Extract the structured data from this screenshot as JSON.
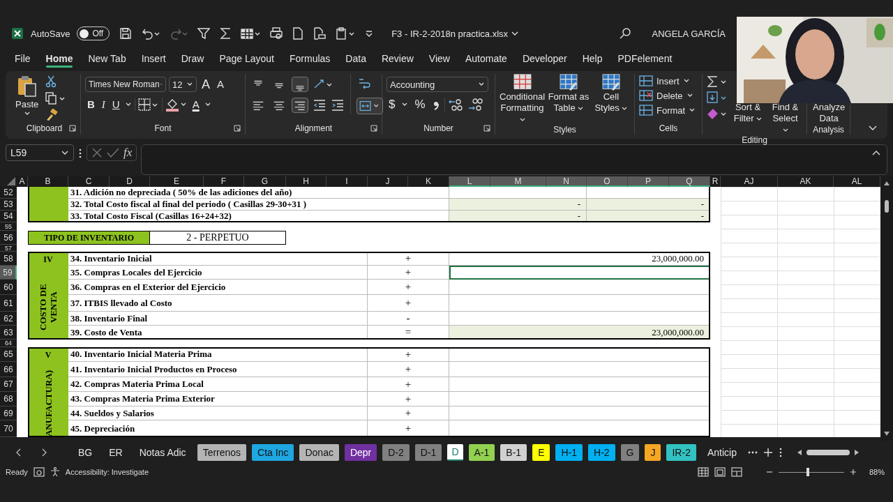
{
  "title_bar": {
    "autosave_label": "AutoSave",
    "autosave": {
      "label": "Off",
      "on": false
    },
    "file_name": "F3 - IR-2-2018n practica.xlsx",
    "user": "ANGELA GARCÍA"
  },
  "menu_tabs": [
    {
      "label": "File",
      "selected": false
    },
    {
      "label": "Home",
      "selected": true
    },
    {
      "label": "New Tab",
      "selected": false
    },
    {
      "label": "Insert",
      "selected": false
    },
    {
      "label": "Draw",
      "selected": false
    },
    {
      "label": "Page Layout",
      "selected": false
    },
    {
      "label": "Formulas",
      "selected": false
    },
    {
      "label": "Data",
      "selected": false
    },
    {
      "label": "Review",
      "selected": false
    },
    {
      "label": "View",
      "selected": false
    },
    {
      "label": "Automate",
      "selected": false
    },
    {
      "label": "Developer",
      "selected": false
    },
    {
      "label": "Help",
      "selected": false
    },
    {
      "label": "PDFelement",
      "selected": false
    }
  ],
  "ribbon": {
    "clipboard": {
      "paste": "Paste",
      "label": "Clipboard"
    },
    "font": {
      "name": "Times New Roman",
      "size": "12",
      "grow": "A",
      "shrink": "A",
      "bold": "B",
      "italic": "I",
      "underline": "U",
      "font_color_label": "A",
      "label": "Font"
    },
    "alignment": {
      "label": "Alignment",
      "vertical_buttons": [
        {
          "kind": "top",
          "selected": false
        },
        {
          "kind": "middle",
          "selected": false
        },
        {
          "kind": "bottom",
          "selected": true
        }
      ],
      "horizontal_buttons": [
        {
          "kind": "left",
          "selected": false
        },
        {
          "kind": "center",
          "selected": false
        },
        {
          "kind": "right",
          "selected": true
        }
      ],
      "merge": {
        "selected": true
      }
    },
    "number": {
      "format": "Accounting",
      "currency": "$",
      "percent": "%",
      "label": "Number"
    },
    "styles": {
      "buttons": [
        "Conditional Formatting",
        "Format as Table",
        "Cell Styles"
      ],
      "label": "Styles"
    },
    "cells": {
      "buttons": [
        "Insert",
        "Delete",
        "Format"
      ],
      "label": "Cells"
    },
    "editing": {
      "buttons": [
        "Sort & Filter",
        "Find & Select"
      ],
      "label": "Editing"
    },
    "analysis": {
      "buttons": [
        "Analyze Data"
      ],
      "label": "Analysis"
    }
  },
  "formula_bar": {
    "name_box": "L59",
    "function_label": "fx"
  },
  "sheet": {
    "columns": [
      {
        "label": "A",
        "selected": false
      },
      {
        "label": "B",
        "selected": false
      },
      {
        "label": "C",
        "selected": false
      },
      {
        "label": "D",
        "selected": false
      },
      {
        "label": "E",
        "selected": false
      },
      {
        "label": "F",
        "selected": false
      },
      {
        "label": "G",
        "selected": false
      },
      {
        "label": "H",
        "selected": false
      },
      {
        "label": "I",
        "selected": false
      },
      {
        "label": "J",
        "selected": false
      },
      {
        "label": "K",
        "selected": false
      },
      {
        "label": "L",
        "selected": true
      },
      {
        "label": "M",
        "selected": true
      },
      {
        "label": "N",
        "selected": true
      },
      {
        "label": "O",
        "selected": true
      },
      {
        "label": "P",
        "selected": true
      },
      {
        "label": "Q",
        "selected": true
      },
      {
        "label": "R",
        "selected": false
      },
      {
        "label": "AJ",
        "selected": false
      },
      {
        "label": "AK",
        "selected": false
      },
      {
        "label": "AL",
        "selected": false
      }
    ],
    "row_numbers": [
      {
        "label": "52",
        "selected": false
      },
      {
        "label": "53",
        "selected": false
      },
      {
        "label": "54",
        "selected": false
      },
      {
        "label": "55",
        "selected": false
      },
      {
        "label": "56",
        "selected": false
      },
      {
        "label": "57",
        "selected": false
      },
      {
        "label": "58",
        "selected": false
      },
      {
        "label": "59",
        "selected": true
      },
      {
        "label": "60",
        "selected": false
      },
      {
        "label": "61",
        "selected": false
      },
      {
        "label": "62",
        "selected": false
      },
      {
        "label": "63",
        "selected": false
      },
      {
        "label": "64",
        "selected": false
      },
      {
        "label": "65",
        "selected": false
      },
      {
        "label": "66",
        "selected": false
      },
      {
        "label": "67",
        "selected": false
      },
      {
        "label": "68",
        "selected": false
      },
      {
        "label": "69",
        "selected": false
      },
      {
        "label": "70",
        "selected": false
      }
    ],
    "top_lines": [
      {
        "label": "31.  Adición no depreciada  ( 50%  de las adiciones del año)",
        "shaded": false
      },
      {
        "label": "32. Total Costo  fiscal al final del periodo ( Casillas 29-30+31 )",
        "left_amount": "-",
        "right_amount": "-",
        "shaded": true
      },
      {
        "label": "33. Total Costo Fiscal (Casillas 16+24+32)",
        "left_amount": "-",
        "right_amount": "-",
        "shaded": true
      }
    ],
    "inventory_type": {
      "label": "TIPO DE INVENTARIO",
      "value": "2 - PERPETUO"
    },
    "sections": [
      {
        "roman": "IV",
        "title": "COSTO DE VENTA",
        "lines": [
          {
            "label": "34. Inventario Inicial",
            "sign": "+",
            "amount": "23,000,000.00",
            "shaded": false,
            "selected": false
          },
          {
            "label": "35. Compras Locales del Ejercicio",
            "sign": "+",
            "shaded": false,
            "selected": true
          },
          {
            "label": "36. Compras en el Exterior del Ejercicio",
            "sign": "+",
            "shaded": false,
            "selected": false
          },
          {
            "label": "37. ITBIS llevado al Costo",
            "sign": "+",
            "shaded": false,
            "selected": false
          },
          {
            "label": "38. Inventario Final",
            "sign": "-",
            "shaded": false,
            "selected": false
          },
          {
            "label": "39. Costo de Venta",
            "sign": "=",
            "amount": "23,000,000.00",
            "shaded": true,
            "selected": false
          }
        ]
      },
      {
        "roman": "V",
        "title": "ANUFACTURA)",
        "lines": [
          {
            "label": "40. Inventario Inicial Materia Prima",
            "sign": "+",
            "shaded": false,
            "selected": false
          },
          {
            "label": "41. Inventario Inicial Productos en Proceso",
            "sign": "+",
            "shaded": false,
            "selected": false
          },
          {
            "label": "42. Compras Materia Prima Local",
            "sign": "+",
            "shaded": false,
            "selected": false
          },
          {
            "label": "43. Compras Materia Prima Exterior",
            "sign": "+",
            "shaded": false,
            "selected": false
          },
          {
            "label": "44. Sueldos y Salarios",
            "sign": "+",
            "shaded": false,
            "selected": false
          },
          {
            "label": "45. Depreciación",
            "sign": "+",
            "shaded": false,
            "selected": false
          }
        ]
      }
    ]
  },
  "sheet_tabs": [
    {
      "label": "BG",
      "selected": false
    },
    {
      "label": "ER",
      "selected": false
    },
    {
      "label": "Notas Adic",
      "selected": false
    },
    {
      "label": "Terrenos",
      "color": "#b4b4b4",
      "selected": false
    },
    {
      "label": "Cta Inc",
      "color": "#1ea7e1",
      "selected": false
    },
    {
      "label": "Donac",
      "color": "#b4b4b4",
      "selected": false
    },
    {
      "label": "Depr",
      "color": "#7030a0",
      "selected": false
    },
    {
      "label": "D-2",
      "color": "#808080",
      "selected": false
    },
    {
      "label": "D-1",
      "color": "#808080",
      "selected": false
    },
    {
      "label": "D",
      "selected": true
    },
    {
      "label": "A-1",
      "color": "#92d050",
      "selected": false
    },
    {
      "label": "B-1",
      "color": "#d0d0d0",
      "selected": false
    },
    {
      "label": "E",
      "color": "#ffff00",
      "selected": false
    },
    {
      "label": "H-1",
      "color": "#00b0f0",
      "selected": false
    },
    {
      "label": "H-2",
      "color": "#00b0f0",
      "selected": false
    },
    {
      "label": "G",
      "color": "#808080",
      "selected": false
    },
    {
      "label": "J",
      "color": "#f5a623",
      "selected": false
    },
    {
      "label": "IR-2",
      "color": "#33c2c2",
      "selected": false
    },
    {
      "label": "Anticip",
      "selected": false
    }
  ],
  "status_bar": {
    "ready": "Ready",
    "accessibility": "Accessibility: Investigate",
    "zoom": "88%",
    "zoom_slider": {
      "level": 0.45
    }
  }
}
